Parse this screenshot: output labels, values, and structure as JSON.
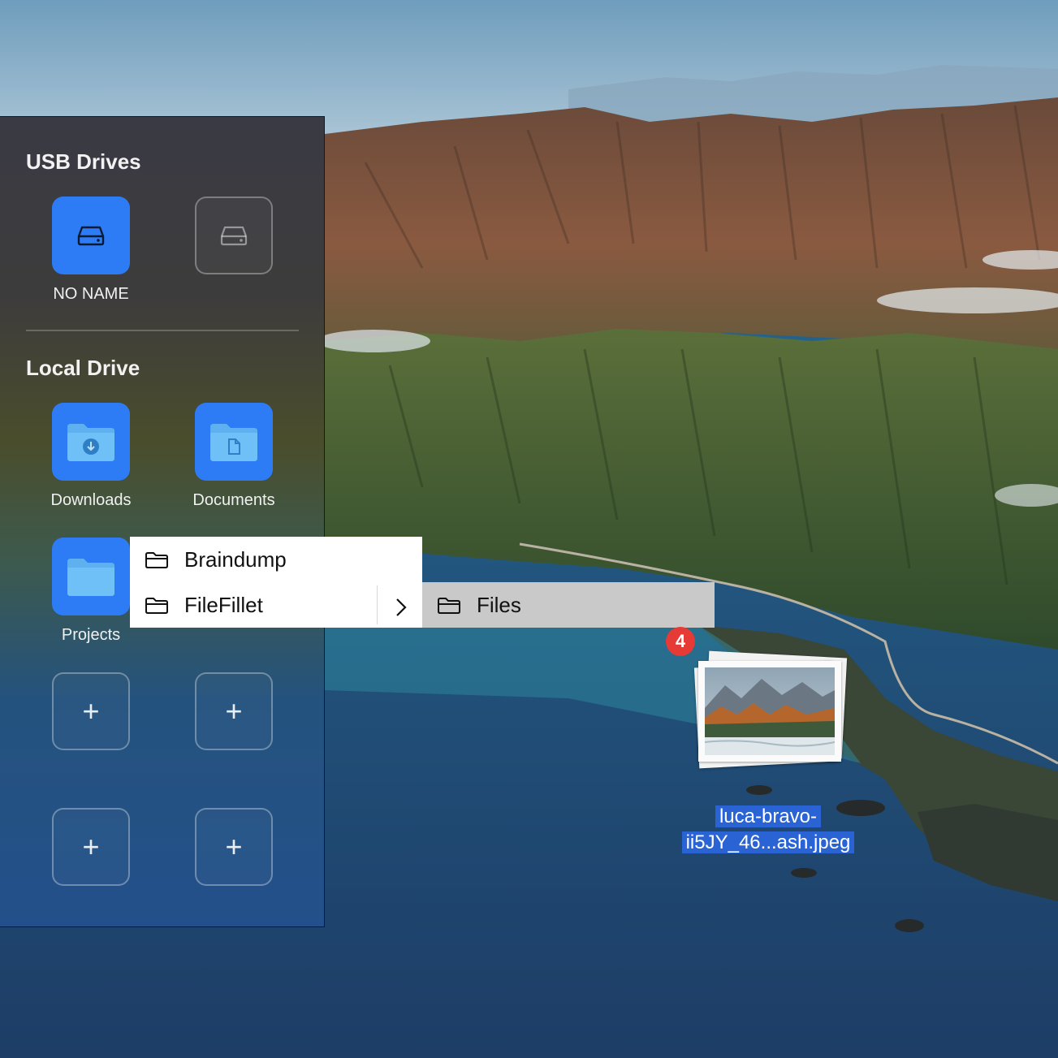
{
  "usb_section": {
    "title": "USB Drives",
    "drives": [
      {
        "label": "NO NAME",
        "icon": "drive-icon",
        "active": true
      },
      {
        "label": "",
        "icon": "drive-icon",
        "active": false
      }
    ]
  },
  "local_section": {
    "title": "Local Drive",
    "folders": [
      {
        "label": "Downloads",
        "icon": "downloads-folder-icon"
      },
      {
        "label": "Documents",
        "icon": "documents-folder-icon"
      },
      {
        "label": "Projects",
        "icon": "folder-icon"
      }
    ],
    "empty_slots": [
      {
        "icon": "plus-icon",
        "glyph": "+"
      },
      {
        "icon": "plus-icon",
        "glyph": "+"
      },
      {
        "icon": "plus-icon",
        "glyph": "+"
      },
      {
        "icon": "plus-icon",
        "glyph": "+"
      }
    ]
  },
  "context_menu": {
    "items": [
      {
        "label": "Braindump",
        "icon": "folder-outline-icon"
      },
      {
        "label": "FileFillet",
        "icon": "folder-outline-icon",
        "has_submenu": true
      }
    ],
    "submenu": {
      "items": [
        {
          "label": "Files",
          "icon": "folder-outline-icon",
          "highlighted": true
        }
      ]
    }
  },
  "drag": {
    "count_badge": "4",
    "file_name_line1": "luca-bravo-",
    "file_name_line2": "ii5JY_46...ash.jpeg"
  },
  "colors": {
    "accent": "#2d7cf6",
    "badge": "#e53a35",
    "selection": "#2a63d3"
  }
}
